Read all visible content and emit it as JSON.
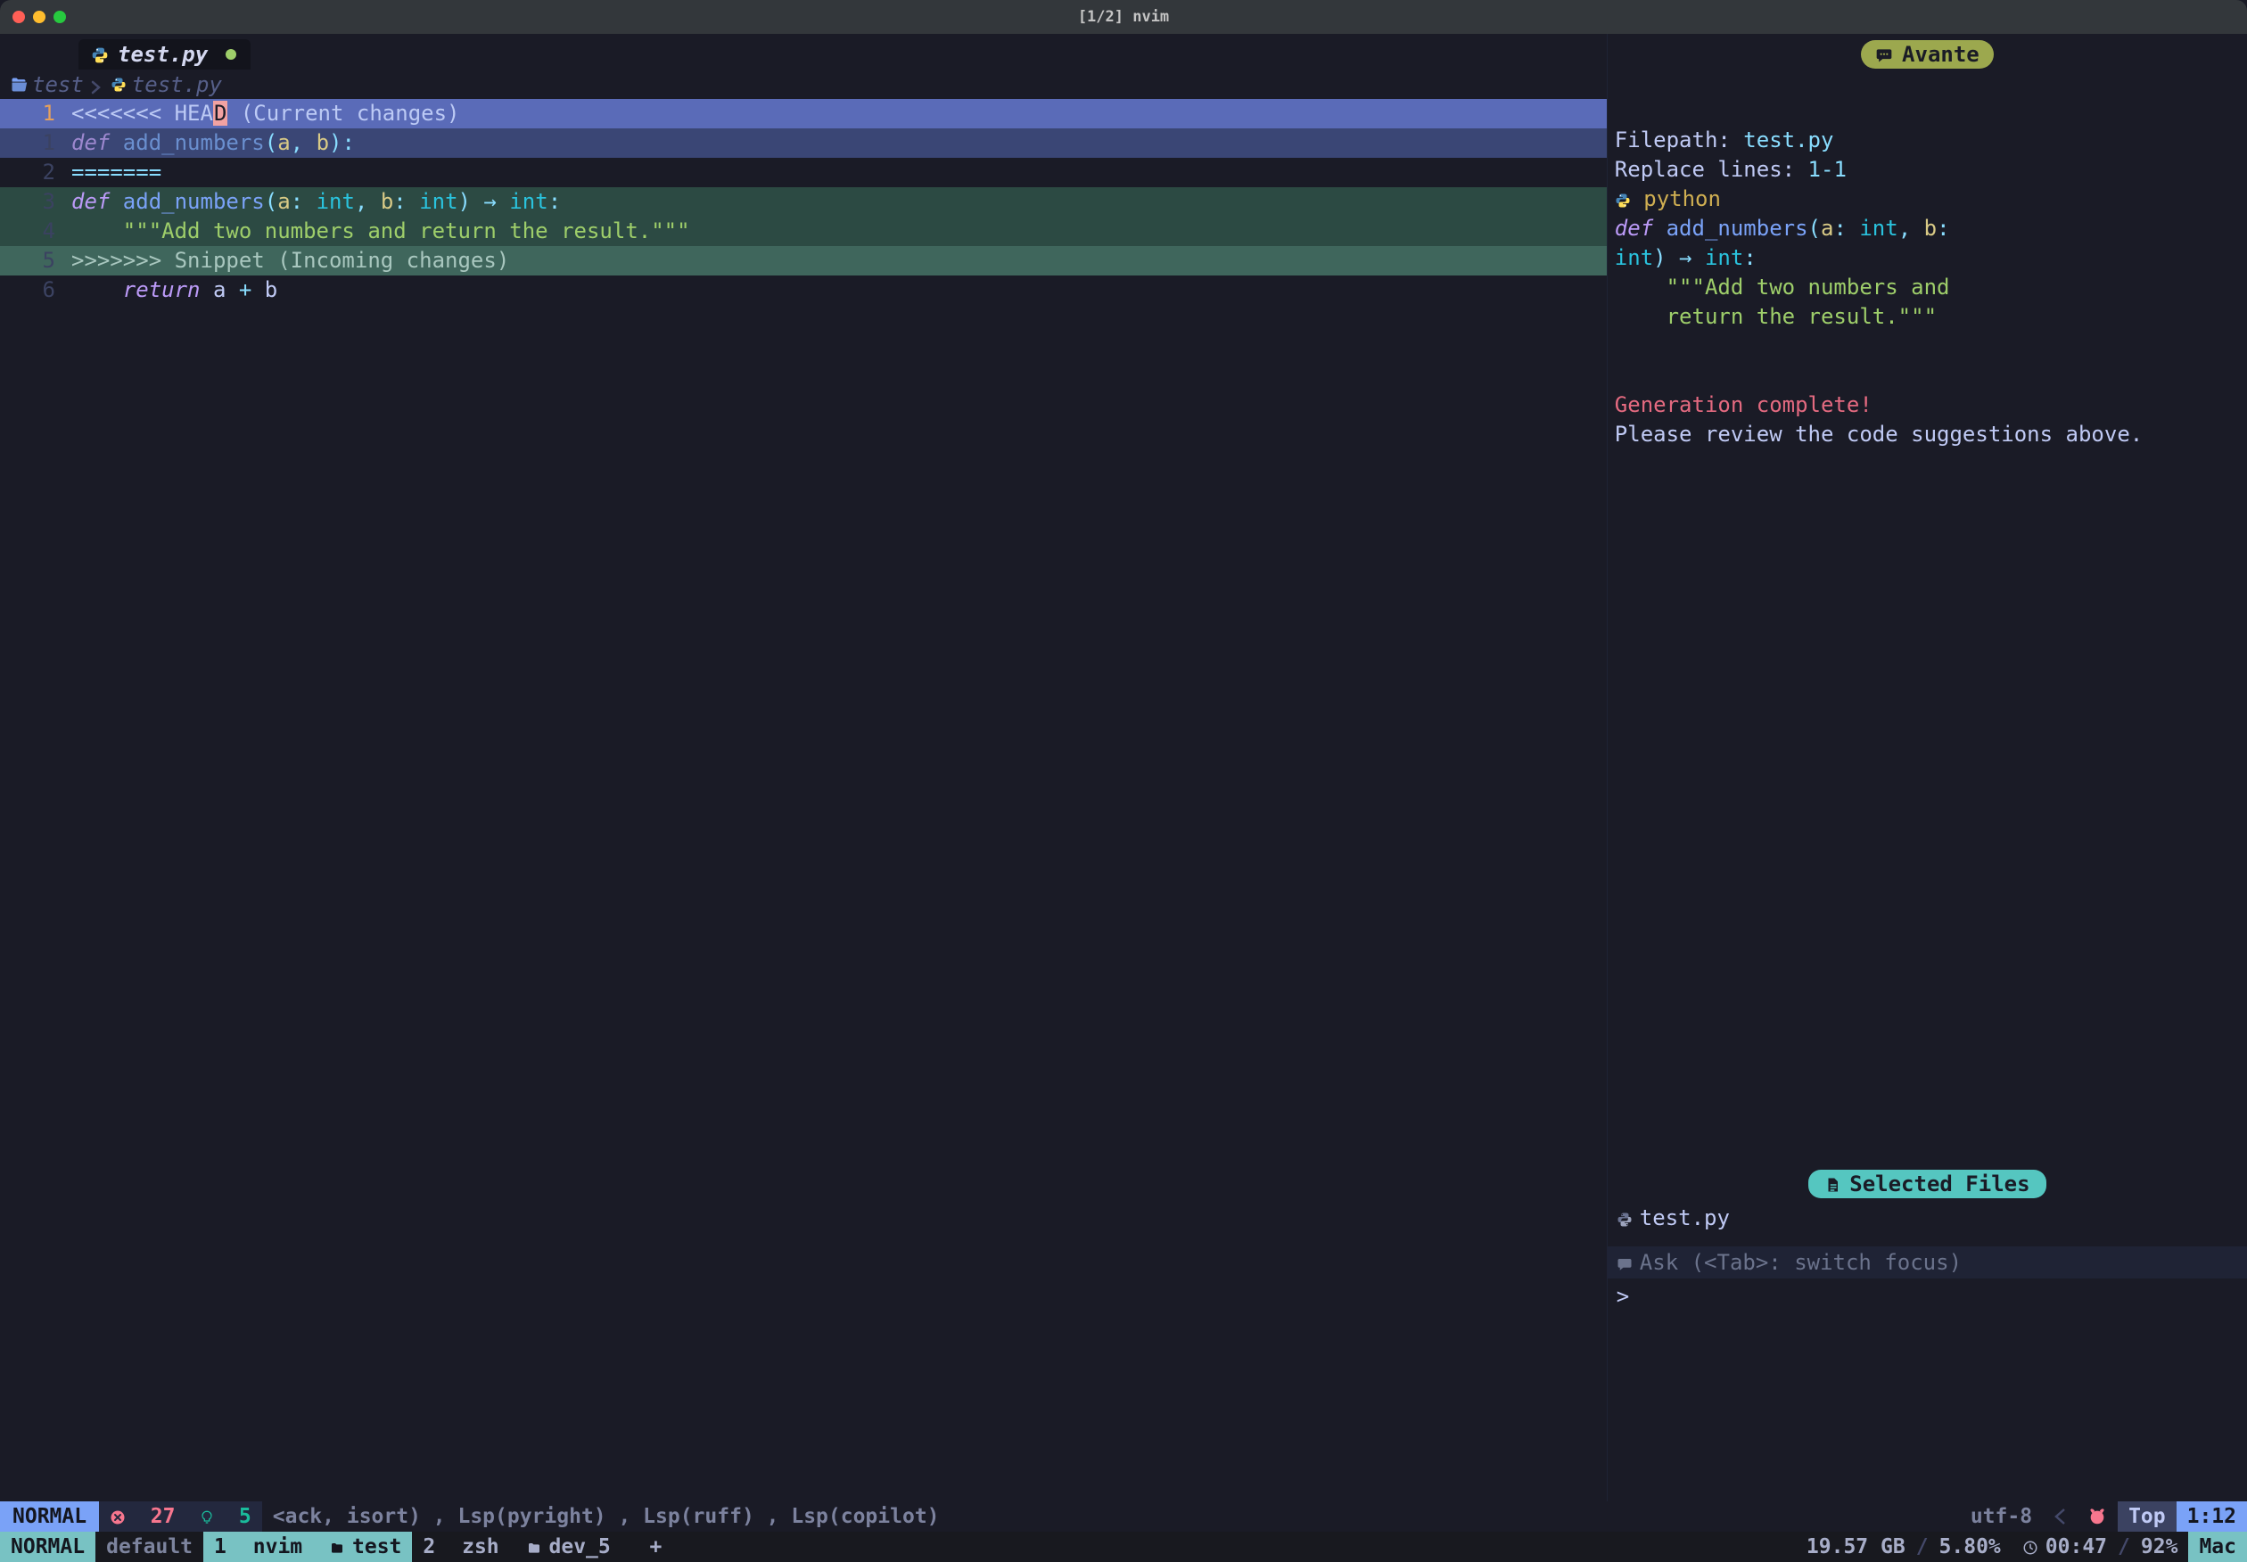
{
  "titlebar": {
    "title": "[1/2] nvim"
  },
  "tab": {
    "filename": "test.py"
  },
  "breadcrumb": {
    "folder": "test",
    "file": "test.py"
  },
  "editor": {
    "gutter_cursor": "1",
    "lines": {
      "l0": {
        "head_prefix": "<<<<<<< HEA",
        "head_cursor": "D",
        "head_rest": " (Current changes)"
      },
      "l1": {
        "g": "1",
        "kw": "def",
        "fn": " add_numbers",
        "p1": "(",
        "a": "a",
        "c": ", ",
        "b": "b",
        "p2": "):"
      },
      "l2": {
        "g": "2",
        "text": "======="
      },
      "l3": {
        "g": "3",
        "kw": "def",
        "fn": " add_numbers",
        "p1": "(",
        "a": "a",
        "ca": ": ",
        "ta": "int",
        "c": ", ",
        "b": "b",
        "cb": ": ",
        "tb": "int",
        "p2": ") ",
        "arrow": "→",
        "sp": " ",
        "tr": "int",
        "colon": ":"
      },
      "l4": {
        "g": "4",
        "pad": "    ",
        "str": "\"\"\"Add two numbers and return the result.\"\"\""
      },
      "l5": {
        "g": "5",
        "text": ">>>>>>> Snippet (Incoming changes)"
      },
      "l6": {
        "g": "6",
        "pad": "    ",
        "kw": "return",
        "sp": " ",
        "a": "a",
        "op": " + ",
        "b": "b"
      }
    }
  },
  "avante": {
    "title": "Avante",
    "filepath_label": "Filepath: ",
    "filepath_value": "test.py",
    "replace_label": "Replace lines: ",
    "replace_value": "1-1",
    "lang": "python",
    "code": {
      "l1a": "def",
      "l1b": " add_numbers",
      "l1c": "(",
      "l1d": "a",
      "l1e": ": ",
      "l1f": "int",
      "l1g": ", ",
      "l1h": "b",
      "l1i": ": ",
      "l2a": "int",
      "l2b": ") ",
      "l2c": "→",
      "l2d": " ",
      "l2e": "int",
      "l2f": ":",
      "l3a": "    ",
      "l3b": "\"\"\"Add two numbers and ",
      "l4a": "    return the result.\"\"\""
    },
    "done1": "Generation complete!",
    "done2": "Please review the code suggestions above."
  },
  "selected": {
    "title": "Selected Files",
    "file": "test.py"
  },
  "ask": {
    "placeholder": "Ask (<Tab>: switch focus)",
    "prompt": ">"
  },
  "status1": {
    "mode": "NORMAL",
    "err_count": "27",
    "hint_count": "5",
    "lsp": "<ack, isort) , Lsp(pyright) , Lsp(ruff) , Lsp(copilot)",
    "encoding": "utf-8",
    "top": "Top",
    "pos": "1:12"
  },
  "status2": {
    "mode": "NORMAL",
    "session": "default",
    "tab1_idx": "1",
    "tab1_cmd": "nvim",
    "tab1_dir": "test",
    "tab2_idx": "2",
    "tab2_cmd": "zsh",
    "tab2_dir": "dev_5",
    "plus": "+",
    "mem": "19.57 GB",
    "cpu": "5.80%",
    "time": "00:47",
    "batt": "92%",
    "host": "Mac"
  }
}
